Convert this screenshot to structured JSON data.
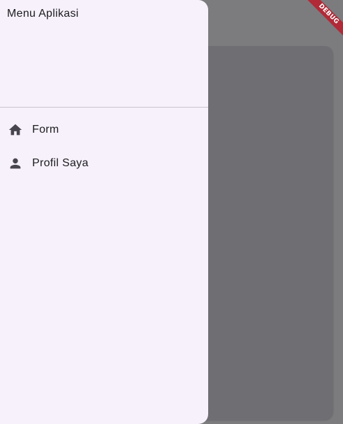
{
  "drawer": {
    "title": "Menu Aplikasi",
    "items": [
      {
        "label": "Form",
        "icon": "home-icon"
      },
      {
        "label": "Profil Saya",
        "icon": "person-icon"
      }
    ]
  },
  "debug_banner": {
    "label": "DEBUG"
  },
  "colors": {
    "drawer_bg": "#f6f1fa",
    "scrim": "#7c7b7e",
    "card": "#6f6e73",
    "icon": "#49454f",
    "banner": "#b02a37"
  }
}
